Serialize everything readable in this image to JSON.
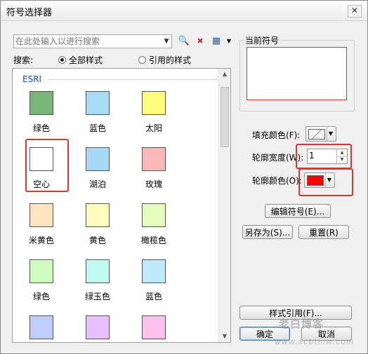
{
  "window": {
    "title": "符号选择器",
    "close": "✕"
  },
  "search": {
    "placeholder": "在此处输入以进行搜索",
    "label": "搜索:"
  },
  "tools": {
    "search_icon": "🔍",
    "clear_icon": "✖",
    "view_icon": "▦"
  },
  "scope": {
    "all": "全部样式",
    "referenced": "引用的样式",
    "selected": "all"
  },
  "gallery": {
    "group": "ESRI",
    "items": [
      {
        "label": "绿色",
        "color": "#77b676"
      },
      {
        "label": "蓝色",
        "color": "#a6dcf4"
      },
      {
        "label": "太阳",
        "color": "#fdfc7b"
      },
      {
        "label": "空心",
        "color": "#ffffff"
      },
      {
        "label": "湖泊",
        "color": "#a7d9f7"
      },
      {
        "label": "玫瑰",
        "color": "#fab8b9"
      },
      {
        "label": "米黄色",
        "color": "#fee5bf"
      },
      {
        "label": "黄色",
        "color": "#fefdbc"
      },
      {
        "label": "橄榄色",
        "color": "#e4fbbe"
      },
      {
        "label": "绿色",
        "color": "#cffdbf"
      },
      {
        "label": "绿玉色",
        "color": "#bffbee"
      },
      {
        "label": "蓝色",
        "color": "#bfe9fd"
      },
      {
        "label": "",
        "color": "#bfcefe"
      },
      {
        "label": "",
        "color": "#e9c0fe"
      },
      {
        "label": "",
        "color": "#fec0ed"
      }
    ]
  },
  "current": {
    "label": "当前符号"
  },
  "props": {
    "fill_label": "填充颜色(F):",
    "outline_width_label": "轮廓宽度(W):",
    "outline_width_value": "1",
    "outline_color_label": "轮廓颜色(O):",
    "outline_color": "#ff0000"
  },
  "buttons": {
    "edit": "编辑符号(E)...",
    "save_as": "另存为(S)...",
    "reset": "重置(R)",
    "style_ref": "样式引用(F)...",
    "ok": "确定",
    "cancel": "取消"
  },
  "watermark": {
    "main": "老白博客",
    "url": "www.xcbtmw.com"
  }
}
